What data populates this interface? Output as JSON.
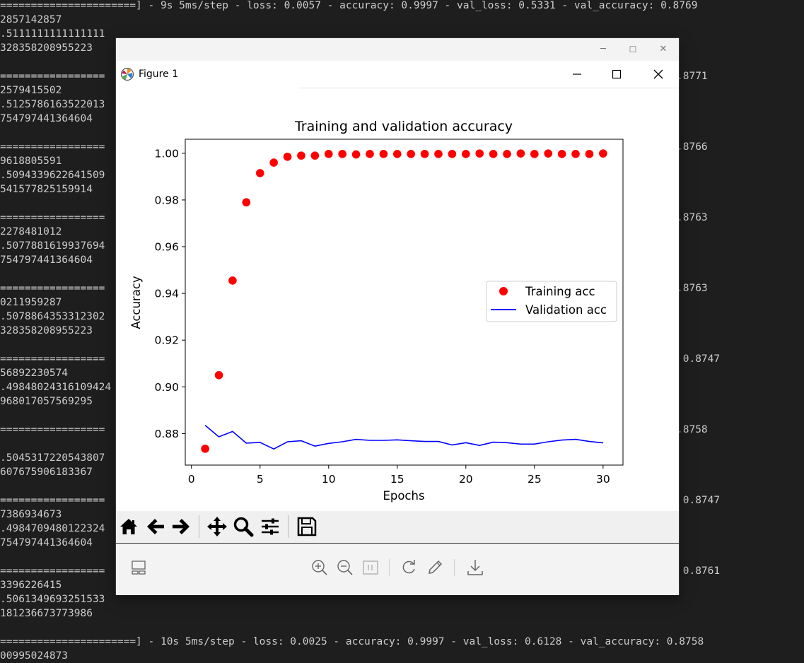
{
  "terminal": {
    "left_lines": [
      "======================] - 9s 5ms/step - loss: 0.0057 - accuracy: 0.9997 - val_loss: 0.5331 - val_accuracy: 0.8769",
      "2857142857",
      ".5111111111111111",
      "328358208955223",
      "",
      "=================",
      "2579415502",
      ".5125786163522013",
      "754797441364604",
      "",
      "=================",
      "9618805591",
      ".5094339622641509",
      "541577825159914",
      "",
      "=================",
      "2278481012",
      ".5077881619937694",
      "754797441364604",
      "",
      "=================",
      "0211959287",
      ".5078864353312302",
      "328358208955223",
      "",
      "=================",
      "56892230574",
      ".49848024316109424",
      "968017057569295",
      "",
      "=================",
      "",
      ".5045317220543807",
      "607675906183367",
      "",
      "=================",
      "7386934673",
      ".4984709480122324",
      "754797441364604",
      "",
      "=================",
      "3396226415",
      ".5061349693251533",
      "181236673773986",
      "",
      "======================] - 10s 5ms/step - loss: 0.0025 - accuracy: 0.9997 - val_loss: 0.6128 - val_accuracy: 0.8758",
      "00995024873"
    ],
    "right_lines": [
      {
        "row": 5,
        "text": ".8771"
      },
      {
        "row": 10,
        "text": ".8766"
      },
      {
        "row": 15,
        "text": ".8763"
      },
      {
        "row": 20,
        "text": ".8763"
      },
      {
        "row": 25,
        "text": " 0.8747"
      },
      {
        "row": 30,
        "text": ".8758"
      },
      {
        "row": 35,
        "text": " 0.8747"
      },
      {
        "row": 40,
        "text": " 0.8761"
      }
    ]
  },
  "window": {
    "minimize_icon": "─",
    "maximize_icon": "☐",
    "close_icon": "✕"
  },
  "figure": {
    "window_title": "Figure 1"
  },
  "chart_data": {
    "type": "scatter",
    "title": "Training and validation accuracy",
    "xlabel": "Epochs",
    "ylabel": "Accuracy",
    "xlim": [
      -0.45,
      31.45
    ],
    "ylim": [
      0.8665,
      1.006
    ],
    "x_ticks": [
      0,
      5,
      10,
      15,
      20,
      25,
      30
    ],
    "y_ticks": [
      0.88,
      0.9,
      0.92,
      0.94,
      0.96,
      0.98,
      1.0
    ],
    "y_tick_labels": [
      "0.88",
      "0.90",
      "0.92",
      "0.94",
      "0.96",
      "0.98",
      "1.00"
    ],
    "legend_position": "center-right",
    "grid": false,
    "series": [
      {
        "name": "Training acc",
        "kind": "points",
        "color": "#ff0000",
        "x": [
          1,
          2,
          3,
          4,
          5,
          6,
          7,
          8,
          9,
          10,
          11,
          12,
          13,
          14,
          15,
          16,
          17,
          18,
          19,
          20,
          21,
          22,
          23,
          24,
          25,
          26,
          27,
          28,
          29,
          30
        ],
        "y": [
          0.8735,
          0.905,
          0.9455,
          0.979,
          0.9915,
          0.996,
          0.9985,
          0.999,
          0.999,
          0.9997,
          0.9997,
          0.9995,
          0.9997,
          0.9997,
          0.9997,
          0.9997,
          0.9997,
          0.9997,
          0.9997,
          0.9997,
          0.9999,
          0.9997,
          0.9997,
          0.9999,
          0.9997,
          0.9999,
          0.9997,
          0.9997,
          0.9997,
          0.9999
        ]
      },
      {
        "name": "Validation acc",
        "kind": "line",
        "color": "#0000ff",
        "x": [
          1,
          2,
          3,
          4,
          5,
          6,
          7,
          8,
          9,
          10,
          11,
          12,
          13,
          14,
          15,
          16,
          17,
          18,
          19,
          20,
          21,
          22,
          23,
          24,
          25,
          26,
          27,
          28,
          29,
          30
        ],
        "y": [
          0.8835,
          0.8786,
          0.8809,
          0.8759,
          0.8762,
          0.8734,
          0.8765,
          0.8769,
          0.8746,
          0.8758,
          0.8765,
          0.8775,
          0.8771,
          0.8771,
          0.8773,
          0.8769,
          0.8766,
          0.8766,
          0.8751,
          0.8761,
          0.8749,
          0.8763,
          0.8761,
          0.8755,
          0.8755,
          0.8765,
          0.8772,
          0.8775,
          0.8766,
          0.876
        ]
      }
    ]
  }
}
